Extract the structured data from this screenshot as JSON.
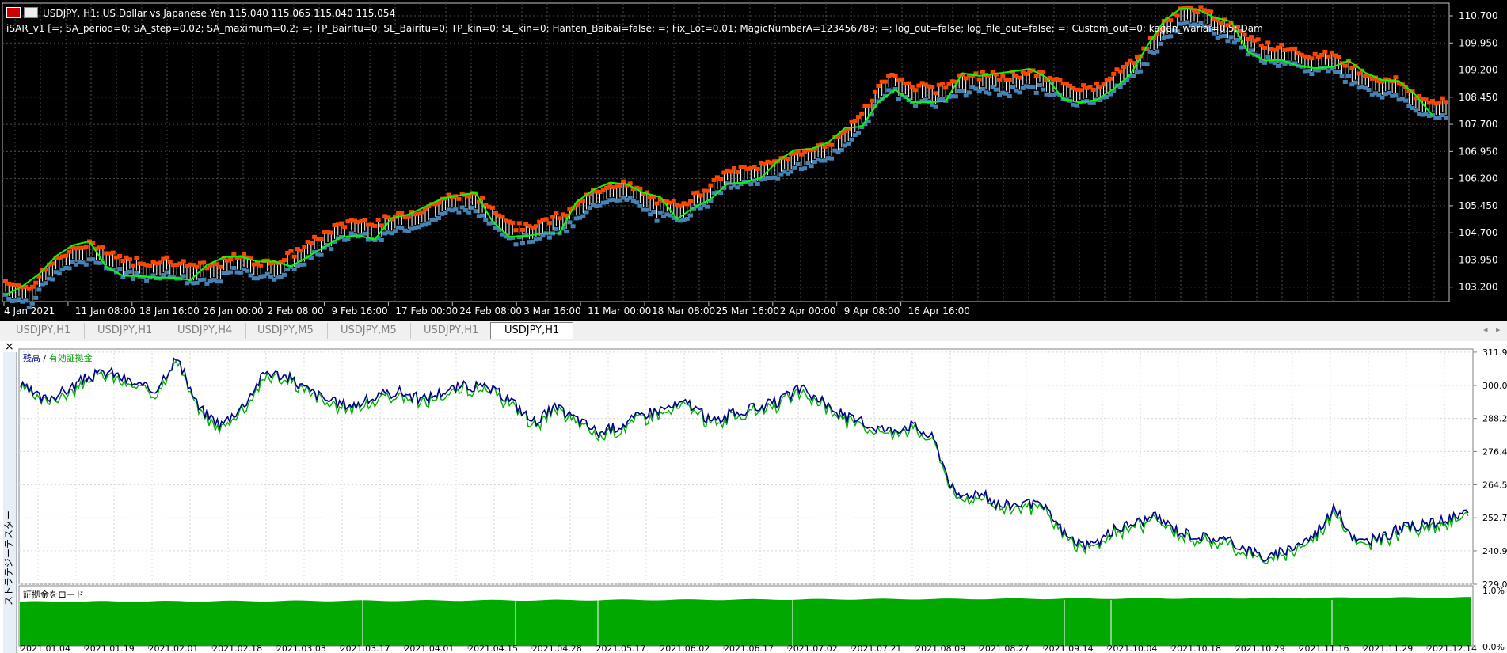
{
  "chart_header": {
    "symbol_line": "USDJPY, H1:  US Dollar vs Japanese Yen  115.040 115.065 115.040 115.054",
    "ea_line": "iSAR_v1 [=; SA_period=0; SA_step=0.02; SA_maximum=0.2; =; TP_Bairitu=0; SL_Bairitu=0; TP_kin=0; SL_kin=0; Hanten_Baibai=false; =; Fix_Lot=0.01; MagicNumberA=123456789; =; log_out=false; log_file_out=false; =; Custom_out=0; kagen_wariai=0.5;  Dam"
  },
  "price_axis_labels": [
    "110.700",
    "109.950",
    "109.200",
    "108.450",
    "107.700",
    "106.950",
    "106.200",
    "105.450",
    "104.700",
    "103.950",
    "103.200"
  ],
  "time_axis_labels": [
    "4 Jan 2021",
    "11 Jan 08:00",
    "18 Jan 16:00",
    "26 Jan 00:00",
    "2 Feb 08:00",
    "9 Feb 16:00",
    "17 Feb 00:00",
    "24 Feb 08:00",
    "3 Mar 16:00",
    "11 Mar 00:00",
    "18 Mar 08:00",
    "25 Mar 16:00",
    "2 Apr 00:00",
    "9 Apr 08:00",
    "16 Apr 16:00"
  ],
  "tabs": [
    "USDJPY,H1",
    "USDJPY,H1",
    "USDJPY,H4",
    "USDJPY,M5",
    "USDJPY,M5",
    "USDJPY,H1",
    "USDJPY,H1"
  ],
  "active_tab": 6,
  "tester": {
    "side_label": "ストラテジーテスター",
    "legend_balance": "残高",
    "legend_sep": " / ",
    "legend_equity": "有効証拠金",
    "margin_label": "証拠金をロード",
    "balance_axis": [
      "311.9",
      "300.0",
      "288.2",
      "276.4",
      "264.5",
      "252.7",
      "240.9",
      "229.0"
    ],
    "margin_axis": [
      "1.0%",
      "0.0%"
    ],
    "date_axis": [
      "2021.01.04",
      "2021.01.19",
      "2021.02.01",
      "2021.02.18",
      "2021.03.03",
      "2021.03.17",
      "2021.04.01",
      "2021.04.15",
      "2021.04.28",
      "2021.05.17",
      "2021.06.02",
      "2021.06.17",
      "2021.07.02",
      "2021.07.21",
      "2021.08.09",
      "2021.08.27",
      "2021.09.14",
      "2021.10.04",
      "2021.10.18",
      "2021.10.29",
      "2021.11.16",
      "2021.11.29",
      "2021.12.14"
    ]
  },
  "colors": {
    "bull": "#ff4500",
    "bear": "#4682b4",
    "sar": "#00ff00",
    "balance": "#00008b",
    "equity": "#00b000",
    "margin": "#00a800"
  },
  "chart_data": [
    {
      "type": "line",
      "series": [
        {
          "name": "USDJPY, H1",
          "values": [
            103.2,
            103.0,
            103.7,
            104.1,
            104.2,
            103.8,
            103.7,
            103.8,
            103.6,
            103.6,
            103.9,
            103.7,
            103.8,
            104.2,
            104.6,
            104.9,
            104.8,
            105.0,
            105.2,
            105.5,
            105.6,
            105.2,
            104.7,
            104.8,
            105.0,
            105.5,
            105.9,
            105.8,
            105.4,
            105.3,
            105.7,
            106.2,
            106.3,
            106.5,
            106.7,
            106.9,
            107.2,
            108.0,
            108.9,
            108.6,
            108.5,
            108.8,
            108.9,
            108.8,
            109.0,
            108.8,
            108.5,
            108.6,
            109.0,
            109.6,
            110.4,
            110.8,
            110.5,
            110.2,
            109.8,
            109.6,
            109.4,
            109.5,
            109.1,
            108.8,
            108.7,
            108.2,
            108.1
          ]
        }
      ],
      "ylim": [
        102.8,
        111.05
      ]
    },
    {
      "type": "line",
      "series": [
        {
          "name": "残高",
          "values": [
            300,
            295,
            298,
            303,
            305,
            301,
            298,
            310,
            292,
            286,
            293,
            305,
            303,
            298,
            294,
            293,
            296,
            298,
            295,
            298,
            300,
            299,
            295,
            287,
            292,
            288,
            283,
            286,
            290,
            292,
            294,
            287,
            290,
            292,
            294,
            299,
            294,
            289,
            286,
            284,
            286,
            281,
            260,
            262,
            257,
            258,
            256,
            246,
            242,
            248,
            251,
            253,
            248,
            246,
            245,
            242,
            238,
            242,
            246,
            256,
            244,
            245,
            249,
            250,
            252,
            254
          ]
        }
      ],
      "ylim": [
        229,
        313
      ]
    }
  ]
}
